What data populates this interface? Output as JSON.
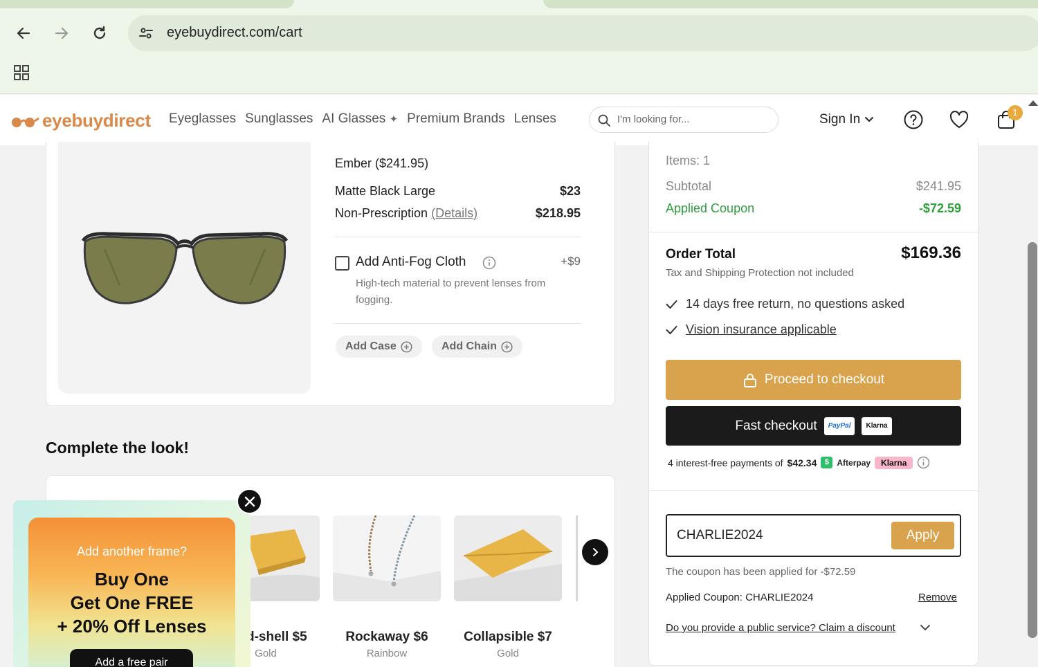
{
  "browser": {
    "url": "eyebuydirect.com/cart"
  },
  "header": {
    "brand": "eyebuydirect",
    "nav": [
      "Eyeglasses",
      "Sunglasses",
      "AI Glasses",
      "Premium Brands",
      "Lenses"
    ],
    "search_placeholder": "I'm looking for...",
    "sign_in": "Sign In",
    "cart_count": "1"
  },
  "cart_item": {
    "name": "Ember ($241.95)",
    "lines": [
      {
        "label": "Matte Black Large",
        "price": "$23"
      },
      {
        "label": "Non-Prescription",
        "link": "(Details)",
        "price": "$218.95"
      }
    ],
    "addon": {
      "title": "Add Anti-Fog Cloth",
      "price": "+$9",
      "description": "High-tech material to prevent lenses from fogging."
    },
    "extras": [
      "Add Case",
      "Add Chain"
    ]
  },
  "complete_look": {
    "title": "Complete the look!",
    "items": [
      {
        "name": "d-shell $5",
        "color": "Gold"
      },
      {
        "name": "Rockaway $6",
        "color": "Rainbow"
      },
      {
        "name": "Collapsible $7",
        "color": "Gold"
      }
    ]
  },
  "promo": {
    "kicker": "Add another frame?",
    "headline_1": "Buy One",
    "headline_2": "Get One FREE",
    "headline_3": "+ 20% Off Lenses",
    "button": "Add a free pair"
  },
  "summary": {
    "items": "Items: 1",
    "subtotal_label": "Subtotal",
    "subtotal": "$241.95",
    "coupon_label": "Applied Coupon",
    "coupon_amount": "-$72.59",
    "total_label": "Order Total",
    "total": "$169.36",
    "tax_note": "Tax and Shipping Protection not included",
    "perks": [
      "14 days free return, no questions asked",
      "Vision insurance applicable"
    ],
    "checkout": "Proceed to checkout",
    "fast_checkout": "Fast checkout",
    "paypal": "PayPal",
    "klarna": "Klarna",
    "installments": "4 interest-free payments of",
    "installment_amount": "$42.34",
    "afterpay": "Afterpay",
    "coupon_code": "CHARLIE2024",
    "apply": "Apply",
    "coupon_message": "The coupon has been applied for -$72.59",
    "applied_coupon": "Applied Coupon: CHARLIE2024",
    "remove": "Remove",
    "public_service": "Do you provide a public service? Claim a discount"
  },
  "colors": {
    "accent_gold": "#d9a24c",
    "brand_orange": "#d9894a",
    "coupon_green": "#2e9e3e"
  }
}
